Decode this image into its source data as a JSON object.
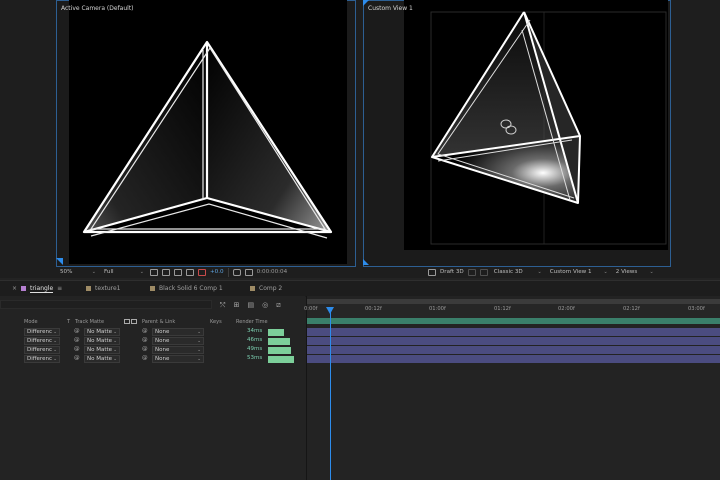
{
  "views": {
    "left": {
      "label": "Active Camera (Default)"
    },
    "right": {
      "label": "Custom View 1"
    }
  },
  "viewer_bar": {
    "zoom": "50%",
    "resolution": "Full",
    "exposure": "+0.0",
    "timecode": "0:00:00:04",
    "renderer": "Draft 3D",
    "renderer_mode": "Classic 3D",
    "view": "Custom View 1",
    "view_layout": "2 Views"
  },
  "tabs": [
    {
      "label": "triangle",
      "color": "#b57fd0",
      "active": true
    },
    {
      "label": "texture1",
      "color": "#9e8b65"
    },
    {
      "label": "Black Solid 6 Comp 1",
      "color": "#9e8b65"
    },
    {
      "label": "Comp 2",
      "color": "#9e8b65"
    }
  ],
  "columns": {
    "mode": "Mode",
    "t": "T",
    "track_matte": "Track Matte",
    "parent": "Parent & Link",
    "keys": "Keys",
    "render_time": "Render Time"
  },
  "layers": [
    {
      "mode": "Differenc",
      "matte": "No Matte",
      "parent": "None",
      "render_time": "34ms",
      "fraction": 0.58
    },
    {
      "mode": "Differenc",
      "matte": "No Matte",
      "parent": "None",
      "render_time": "46ms",
      "fraction": 0.78
    },
    {
      "mode": "Differenc",
      "matte": "No Matte",
      "parent": "None",
      "render_time": "49ms",
      "fraction": 0.83
    },
    {
      "mode": "Differenc",
      "matte": "No Matte",
      "parent": "None",
      "render_time": "53ms",
      "fraction": 0.9
    }
  ],
  "ruler": [
    "0:00f",
    "00:12f",
    "01:00f",
    "01:12f",
    "02:00f",
    "02:12f",
    "03:00f"
  ],
  "colors": {
    "panel_accent": "#2d8ceb",
    "track": "#4b4c80",
    "render_bar": "#7ccf9a",
    "work_area": "#3a7f6a"
  }
}
